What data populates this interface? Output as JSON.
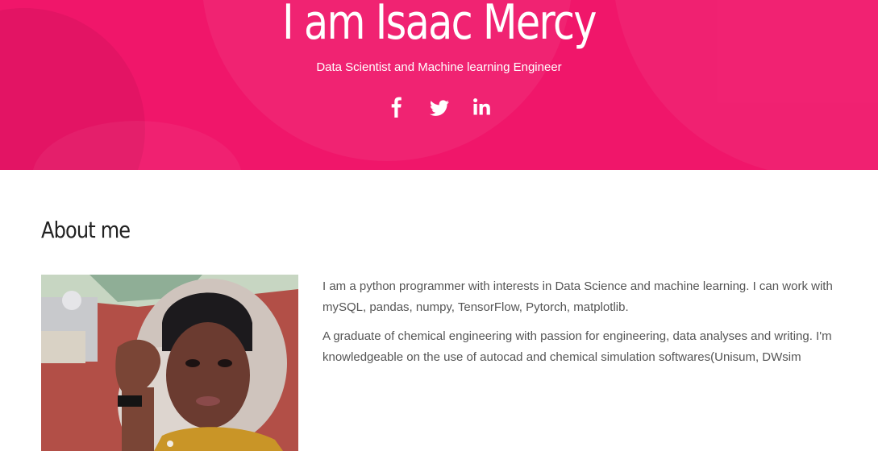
{
  "hero": {
    "title": "I am Isaac Mercy",
    "subtitle": "Data Scientist and Machine learning Engineer",
    "background_color": "#f0166a",
    "social_links": [
      {
        "icon": "facebook-icon"
      },
      {
        "icon": "twitter-icon"
      },
      {
        "icon": "linkedin-icon"
      }
    ]
  },
  "about": {
    "heading": "About me",
    "paragraphs": [
      "I am a python programmer with interests in Data Science and machine learning. I can work with mySQL, pandas, numpy, TensorFlow, Pytorch, matplotlib.",
      "A graduate of chemical engineering with passion for engineering, data analyses and writing. I'm knowledgeable on the use of autocad and chemical simulation softwares(Unisum, DWsim"
    ]
  },
  "colors": {
    "accent_pink": "#f0166a",
    "body_text": "#555555",
    "heading_text": "#222222"
  }
}
